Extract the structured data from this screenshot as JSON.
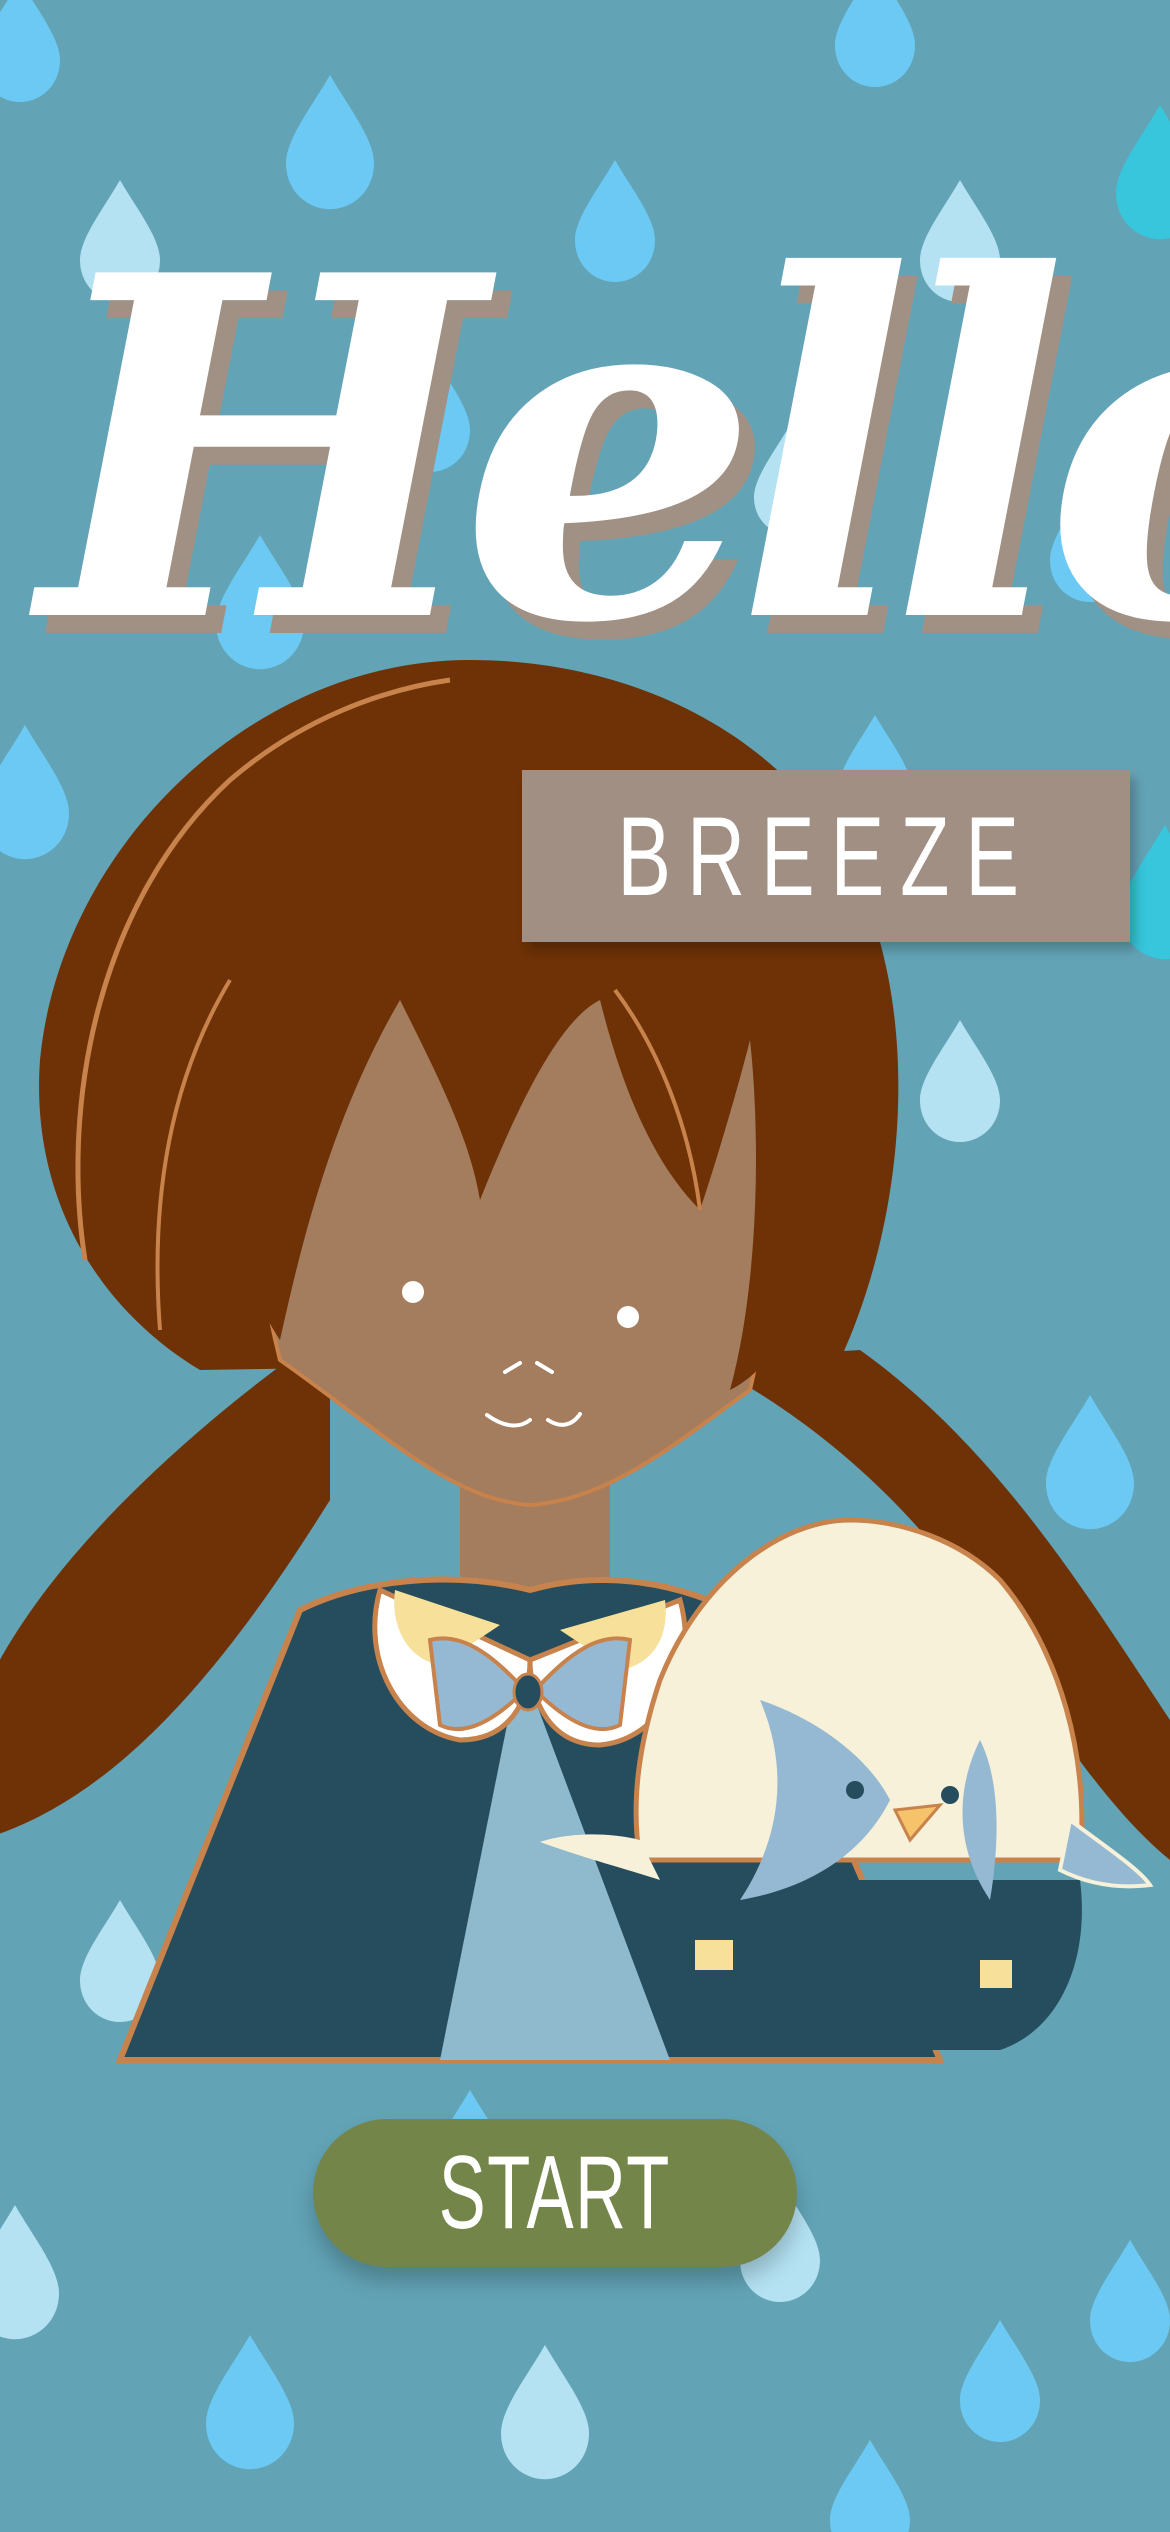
{
  "splash": {
    "greeting": "Hello",
    "name_label": "BREEZE",
    "start_label": "START"
  },
  "colors": {
    "background": "#62a4b6",
    "greeting_text": "#ffffff",
    "greeting_shadow": "#a19185",
    "name_label_bg": "#a08f82",
    "start_button_bg": "#74854a",
    "hair": "#6e3206",
    "skin": "#a47c5e",
    "cape": "#254d5d",
    "bird_body": "#f7f1da"
  },
  "icons": [
    "raindrop-pattern",
    "girl-character-illustration",
    "bird-companion-illustration"
  ]
}
